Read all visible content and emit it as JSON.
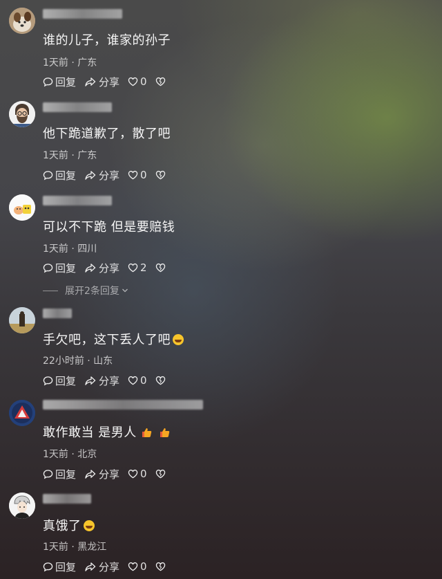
{
  "comments": [
    {
      "text": "谁的儿子，谁家的孙子",
      "meta": "1天前 · 广东",
      "reply_label": "回复",
      "share_label": "分享",
      "likes": "0"
    },
    {
      "text": "他下跪道歉了，散了吧",
      "meta": "1天前 · 广东",
      "reply_label": "回复",
      "share_label": "分享",
      "likes": "0"
    },
    {
      "text": "可以不下跪 但是要赔钱",
      "meta": "1天前 · 四川",
      "reply_label": "回复",
      "share_label": "分享",
      "likes": "2",
      "expand_label": "展开2条回复"
    },
    {
      "text": "手欠吧，这下丢人了吧",
      "meta": "22小时前 · 山东",
      "reply_label": "回复",
      "share_label": "分享",
      "likes": "0"
    },
    {
      "text": "敢作敢当 是男人",
      "meta": "1天前 · 北京",
      "reply_label": "回复",
      "share_label": "分享",
      "likes": "0"
    },
    {
      "text": "真饿了",
      "meta": "1天前 · 黑龙江",
      "reply_label": "回复",
      "share_label": "分享",
      "likes": "0"
    }
  ],
  "icons": {
    "reply": "comment-bubble-icon",
    "share": "share-arrow-icon",
    "like": "heart-icon",
    "dislike": "broken-heart-icon",
    "expand": "chevron-down-icon",
    "laugh": "laughing-emoji-icon",
    "thumbs_up": "thumbs-up-icon"
  },
  "colors": {
    "emoji_yellow": "#f7c52b",
    "thumb_orange": "#f6a623"
  }
}
